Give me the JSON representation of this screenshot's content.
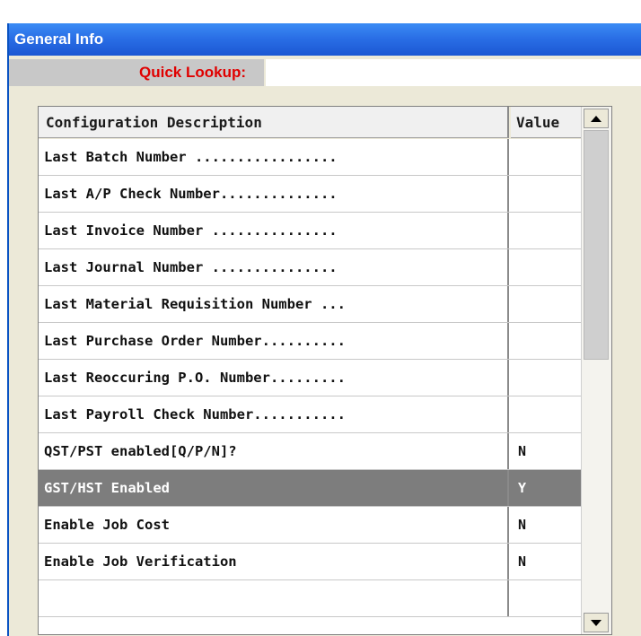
{
  "window": {
    "title": "General Info"
  },
  "lookup": {
    "label": "Quick Lookup:",
    "value": ""
  },
  "grid": {
    "columns": [
      "Configuration Description",
      "Value"
    ],
    "rows": [
      {
        "description": "Last Batch Number .................",
        "value": ""
      },
      {
        "description": "Last A/P Check Number..............",
        "value": ""
      },
      {
        "description": "Last Invoice Number ...............",
        "value": ""
      },
      {
        "description": "Last Journal Number ...............",
        "value": ""
      },
      {
        "description": "Last Material Requisition Number ...",
        "value": ""
      },
      {
        "description": "Last Purchase Order Number..........",
        "value": ""
      },
      {
        "description": "Last Reoccuring P.O. Number.........",
        "value": ""
      },
      {
        "description": "Last Payroll Check Number...........",
        "value": ""
      },
      {
        "description": "QST/PST enabled[Q/P/N]?",
        "value": "N"
      },
      {
        "description": "GST/HST Enabled",
        "value": "Y",
        "selected": true
      },
      {
        "description": "Enable Job Cost",
        "value": "N"
      },
      {
        "description": "Enable Job Verification",
        "value": "N"
      },
      {
        "description": "",
        "value": ""
      }
    ]
  },
  "colors": {
    "titlebar": "#2a6fe6",
    "lookup_label": "#e00000",
    "selected_row": "#7d7d7d"
  },
  "icons": {
    "scroll_up": "triangle-up-icon",
    "scroll_down": "triangle-down-icon"
  }
}
